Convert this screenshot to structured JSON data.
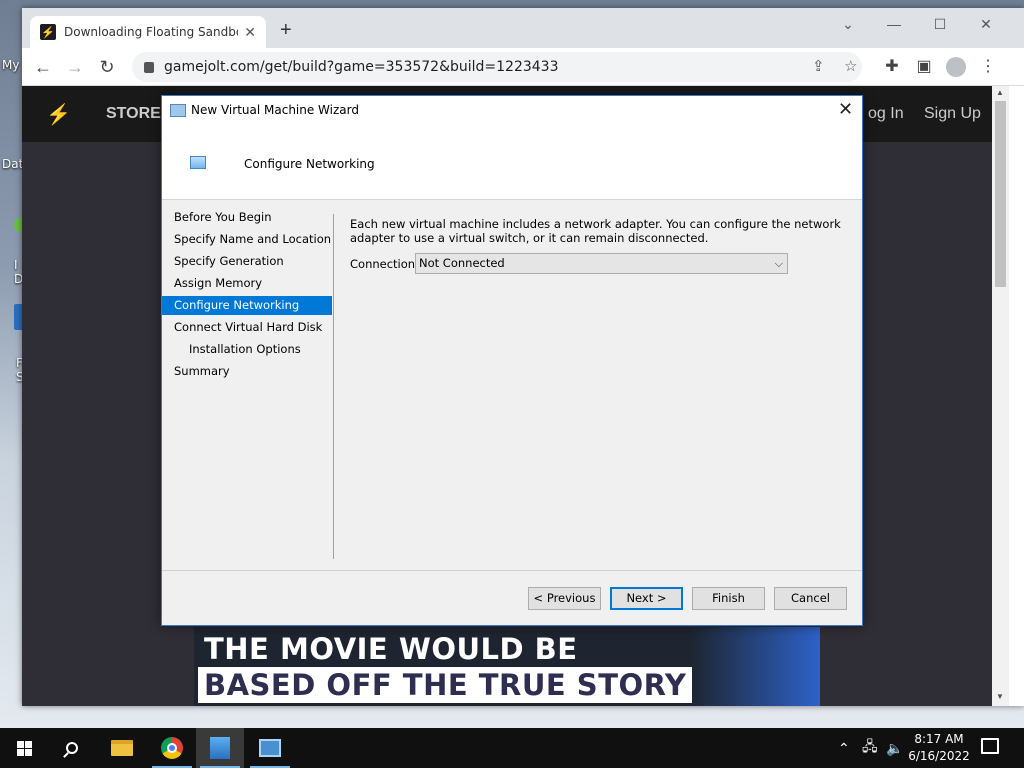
{
  "desktop": {
    "labels": [
      "My",
      "Dat",
      "I",
      "D",
      "F",
      "S"
    ]
  },
  "browser": {
    "tab_title": "Downloading Floating Sandbox",
    "tab_close": "✕",
    "new_tab": "+",
    "url": "gamejolt.com/get/build?game=353572&build=1223433",
    "window_controls": {
      "minimize": "—",
      "maximize": "☐",
      "close": "✕",
      "tabsearch": "⌄"
    }
  },
  "site": {
    "store": "STORE",
    "login": "og In",
    "signup": "Sign Up",
    "caption_line1": "THE MOVIE WOULD BE",
    "caption_line2": "BASED OFF THE TRUE STORY"
  },
  "dialog": {
    "title": "New Virtual Machine Wizard",
    "header": "Configure Networking",
    "nav": [
      {
        "label": "Before You Begin"
      },
      {
        "label": "Specify Name and Location"
      },
      {
        "label": "Specify Generation"
      },
      {
        "label": "Assign Memory"
      },
      {
        "label": "Configure Networking",
        "active": true
      },
      {
        "label": "Connect Virtual Hard Disk"
      },
      {
        "label": "Installation Options",
        "sub": true
      },
      {
        "label": "Summary"
      }
    ],
    "description": "Each new virtual machine includes a network adapter. You can configure the network adapter to use a virtual switch, or it can remain disconnected.",
    "connection_label": "Connection:",
    "connection_value": "Not Connected",
    "buttons": {
      "previous": "< Previous",
      "next": "Next >",
      "finish": "Finish",
      "cancel": "Cancel"
    }
  },
  "taskbar": {
    "time": "8:17 AM",
    "date": "6/16/2022"
  },
  "colors": {
    "selection": "#0078d7",
    "site_header": "#191919",
    "taskbar": "#101010"
  }
}
